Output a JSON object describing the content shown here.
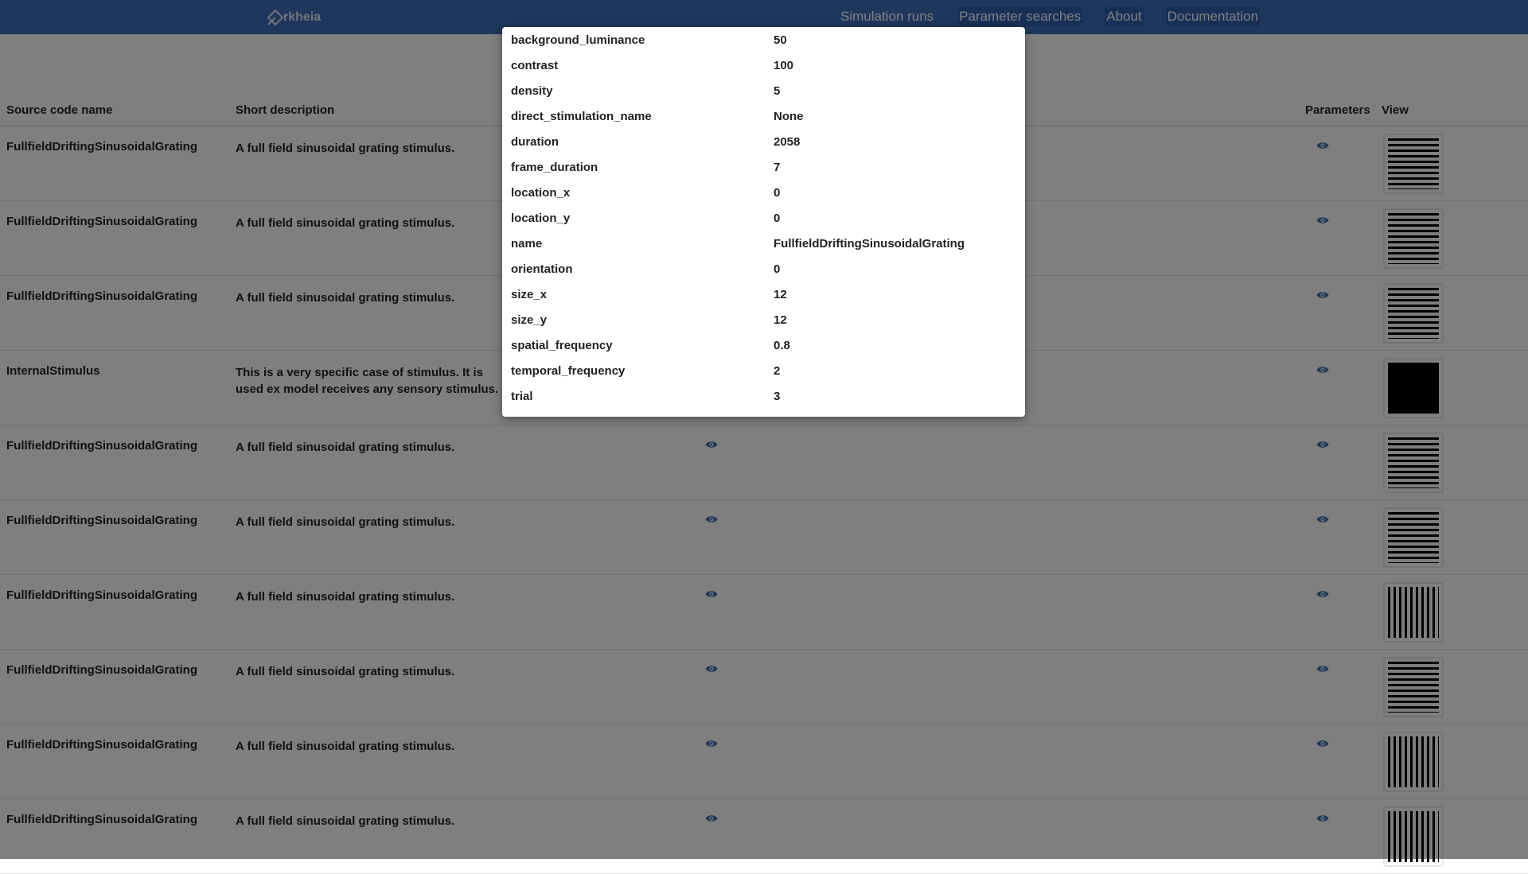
{
  "header": {
    "logo_text": "rkheia",
    "nav": [
      "Simulation runs",
      "Parameter searches",
      "About",
      "Documentation"
    ]
  },
  "table": {
    "columns": {
      "name": "Source code name",
      "description": "Short description",
      "parameters": "Parameters",
      "view": "View"
    },
    "rows": [
      {
        "name": "FullfieldDriftingSinusoidalGrating",
        "description": "A full field sinusoidal grating stimulus.",
        "thumbnail": "horizontal-grating"
      },
      {
        "name": "FullfieldDriftingSinusoidalGrating",
        "description": "A full field sinusoidal grating stimulus.",
        "thumbnail": "horizontal-grating"
      },
      {
        "name": "FullfieldDriftingSinusoidalGrating",
        "description": "A full field sinusoidal grating stimulus.",
        "thumbnail": "horizontal-grating"
      },
      {
        "name": "InternalStimulus",
        "description": "This is a very specific case of stimulus. It is used ex model receives any sensory stimulus.",
        "thumbnail": "black"
      },
      {
        "name": "FullfieldDriftingSinusoidalGrating",
        "description": "A full field sinusoidal grating stimulus.",
        "thumbnail": "horizontal-grating"
      },
      {
        "name": "FullfieldDriftingSinusoidalGrating",
        "description": "A full field sinusoidal grating stimulus.",
        "thumbnail": "horizontal-grating"
      },
      {
        "name": "FullfieldDriftingSinusoidalGrating",
        "description": "A full field sinusoidal grating stimulus.",
        "thumbnail": "vertical-grating"
      },
      {
        "name": "FullfieldDriftingSinusoidalGrating",
        "description": "A full field sinusoidal grating stimulus.",
        "thumbnail": "horizontal-grating"
      },
      {
        "name": "FullfieldDriftingSinusoidalGrating",
        "description": "A full field sinusoidal grating stimulus.",
        "thumbnail": "vertical-grating"
      },
      {
        "name": "FullfieldDriftingSinusoidalGrating",
        "description": "A full field sinusoidal grating stimulus.",
        "thumbnail": "vertical-grating"
      }
    ]
  },
  "modal": {
    "params": [
      {
        "key": "background_luminance",
        "value": "50"
      },
      {
        "key": "contrast",
        "value": "100"
      },
      {
        "key": "density",
        "value": "5"
      },
      {
        "key": "direct_stimulation_name",
        "value": "None"
      },
      {
        "key": "duration",
        "value": "2058"
      },
      {
        "key": "frame_duration",
        "value": "7"
      },
      {
        "key": "location_x",
        "value": "0"
      },
      {
        "key": "location_y",
        "value": "0"
      },
      {
        "key": "name",
        "value": "FullfieldDriftingSinusoidalGrating"
      },
      {
        "key": "orientation",
        "value": "0"
      },
      {
        "key": "size_x",
        "value": "12"
      },
      {
        "key": "size_y",
        "value": "12"
      },
      {
        "key": "spatial_frequency",
        "value": "0.8"
      },
      {
        "key": "temporal_frequency",
        "value": "2"
      },
      {
        "key": "trial",
        "value": "3"
      }
    ]
  },
  "colors": {
    "header_bg": "#3f6fb8",
    "icon": "#3d6fb0",
    "overlay": "rgba(0,0,0,0.5)"
  }
}
